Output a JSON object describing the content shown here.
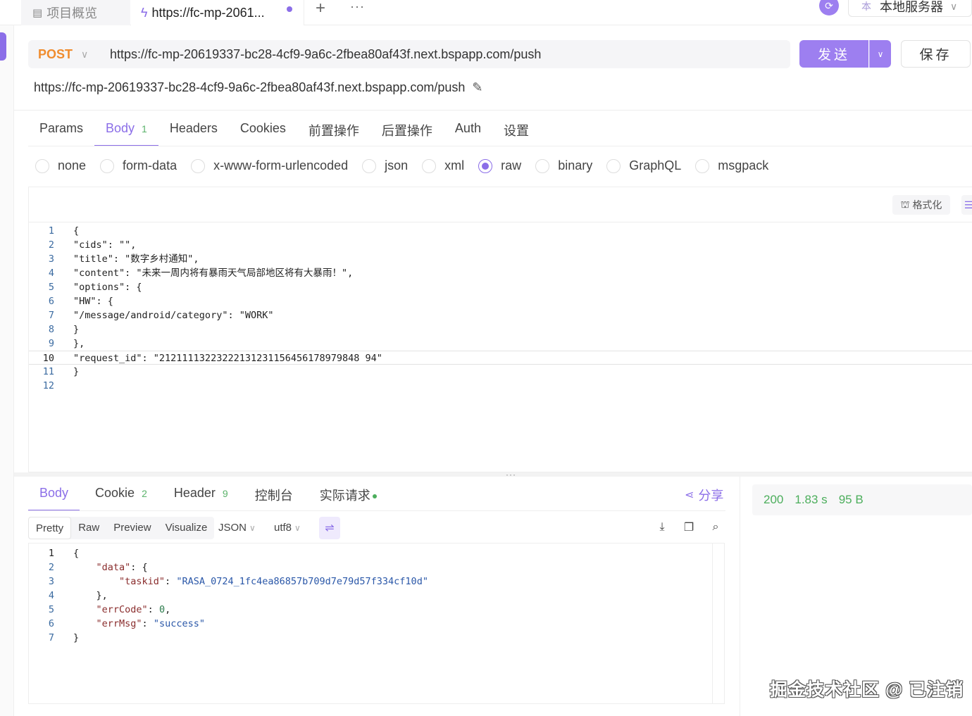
{
  "tabs": {
    "overview_label": "项目概览",
    "request_label": "https://fc-mp-2061...",
    "environment": {
      "badge": "本",
      "label": "本地服务器"
    }
  },
  "request": {
    "method": "POST",
    "url": "https://fc-mp-20619337-bc28-4cf9-9a6c-2fbea80af43f.next.bspapp.com/push",
    "title": "https://fc-mp-20619337-bc28-4cf9-9a6c-2fbea80af43f.next.bspapp.com/push",
    "send_label": "发送",
    "save_label": "保存"
  },
  "request_tabs": [
    {
      "label": "Params",
      "count": ""
    },
    {
      "label": "Body",
      "count": "1"
    },
    {
      "label": "Headers",
      "count": ""
    },
    {
      "label": "Cookies",
      "count": ""
    },
    {
      "label": "前置操作",
      "count": ""
    },
    {
      "label": "后置操作",
      "count": ""
    },
    {
      "label": "Auth",
      "count": ""
    },
    {
      "label": "设置",
      "count": ""
    }
  ],
  "body_types": [
    "none",
    "form-data",
    "x-www-form-urlencoded",
    "json",
    "xml",
    "raw",
    "binary",
    "GraphQL",
    "msgpack"
  ],
  "body_type_selected": "raw",
  "editor": {
    "format_label": "格式化",
    "lines": [
      "{",
      "\"cids\": \"\",",
      "\"title\": \"数字乡村通知\",",
      "\"content\": \"未来一周内将有暴雨天气局部地区将有大暴雨！\",",
      "\"options\": {",
      "\"HW\": {",
      "\"/message/android/category\": \"WORK\"",
      "}",
      "},",
      "\"request_id\": \"21211113223222131231156456178979848 94\"",
      "}",
      ""
    ],
    "highlighted_line": 10
  },
  "response_tabs": [
    {
      "label": "Body",
      "count": ""
    },
    {
      "label": "Cookie",
      "count": "2"
    },
    {
      "label": "Header",
      "count": "9"
    },
    {
      "label": "控制台",
      "count": ""
    },
    {
      "label": "实际请求",
      "count": ""
    }
  ],
  "share_label": "分享",
  "view_options": [
    "Pretty",
    "Raw",
    "Preview",
    "Visualize"
  ],
  "format_select": "JSON",
  "encoding_select": "utf8",
  "response": {
    "status": "200",
    "time": "1.83 s",
    "size": "95 B"
  },
  "response_body": {
    "taskid": "RASA_0724_1fc4ea86857b709d7e79d57f334cf10d",
    "errCode": "0",
    "errMsg": "success"
  },
  "watermark": "掘金技术社区 @ 已注销",
  "colors": {
    "accent": "#8b6ee8",
    "method": "#f08c2e",
    "success": "#4cae5c"
  }
}
